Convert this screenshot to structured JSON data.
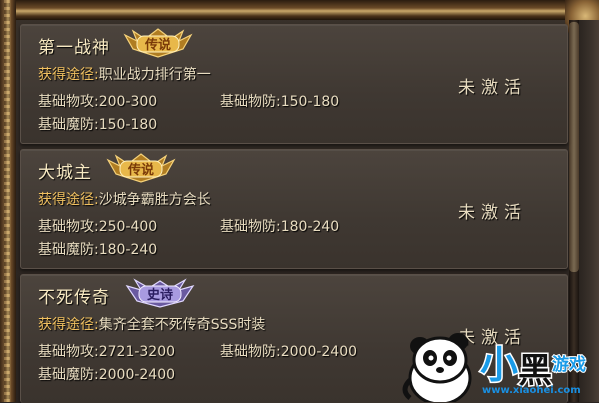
{
  "items": [
    {
      "title": "第一战神",
      "badge": "传说",
      "badge_type": "legend",
      "source_label": "获得途径:",
      "source_value": "职业战力排行第一",
      "atk_label": "基础物攻:",
      "atk_value": "200-300",
      "def_label": "基础物防:",
      "def_value": "150-180",
      "mdef_label": "基础魔防:",
      "mdef_value": "150-180",
      "status": "未激活"
    },
    {
      "title": "大城主",
      "badge": "传说",
      "badge_type": "legend",
      "source_label": "获得途径:",
      "source_value": "沙城争霸胜方会长",
      "atk_label": "基础物攻:",
      "atk_value": "250-400",
      "def_label": "基础物防:",
      "def_value": "180-240",
      "mdef_label": "基础魔防:",
      "mdef_value": "180-240",
      "status": "未激活"
    },
    {
      "title": "不死传奇",
      "badge": "史诗",
      "badge_type": "epic",
      "source_label": "获得途径:",
      "source_value": "集齐全套不死传奇SSS时装",
      "atk_label": "基础物攻:",
      "atk_value": "2721-3200",
      "def_label": "基础物防:",
      "def_value": "2000-2400",
      "mdef_label": "基础魔防:",
      "mdef_value": "2000-2400",
      "status": "未激活"
    }
  ],
  "watermark": {
    "brand": "小黑游戏",
    "url": "www.xiaohei.com"
  },
  "colors": {
    "legend_badge": "#d8a940",
    "epic_badge": "#9a8ad0",
    "source_label": "#f0c060",
    "text": "#e8dcc0"
  }
}
